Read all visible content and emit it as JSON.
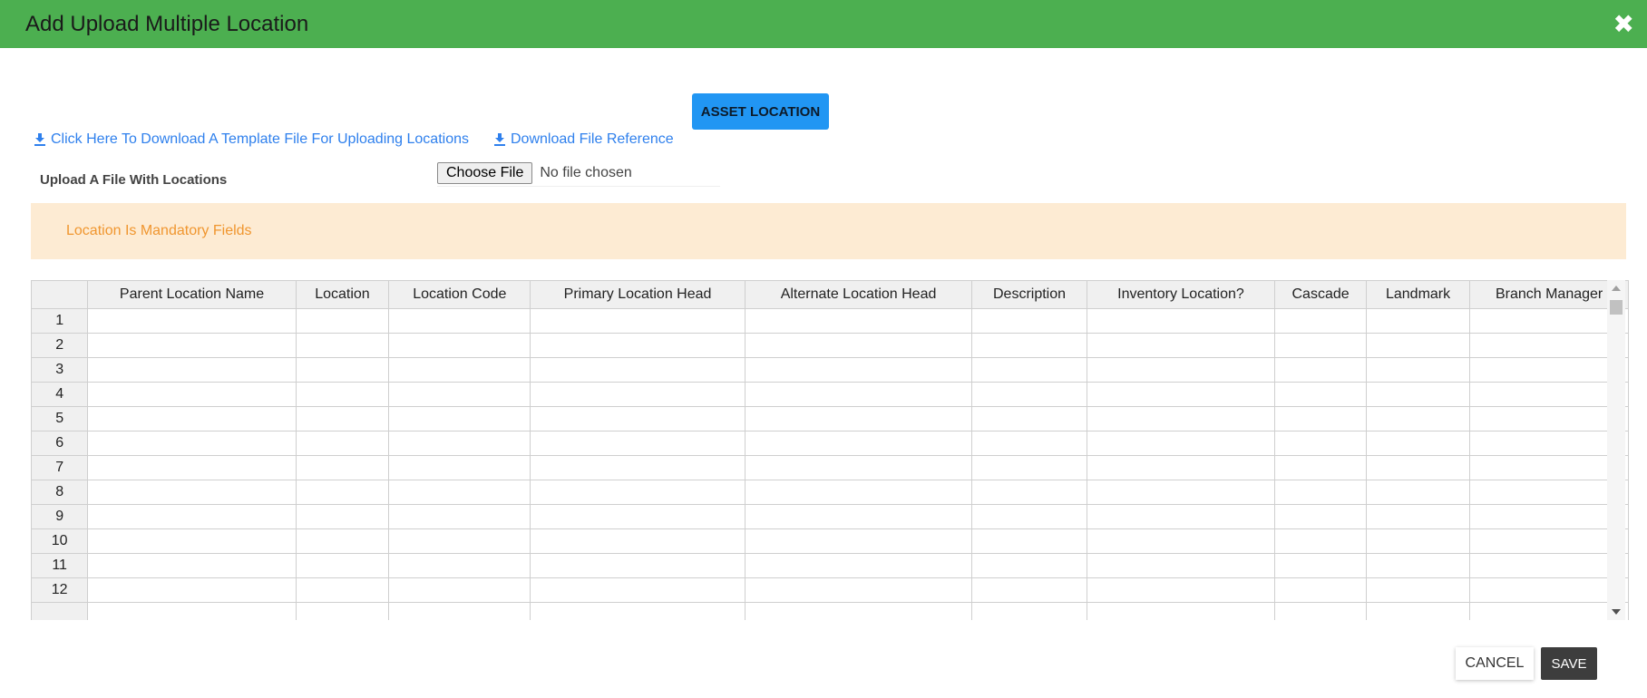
{
  "header": {
    "title": "Add Upload Multiple Location",
    "close_icon": "close-icon"
  },
  "asset_button": {
    "label": "ASSET LOCATION"
  },
  "links": {
    "template": "Click Here To Download A Template File For Uploading Locations",
    "reference": "Download File Reference"
  },
  "upload": {
    "label": "Upload A File With Locations",
    "choose_label": "Choose File",
    "status": "No file chosen"
  },
  "alert": {
    "text": "Location Is Mandatory Fields"
  },
  "grid": {
    "columns": [
      "Parent Location Name",
      "Location",
      "Location Code",
      "Primary Location Head",
      "Alternate Location Head",
      "Description",
      "Inventory Location?",
      "Cascade",
      "Landmark",
      "Branch Manager"
    ],
    "rows": [
      "1",
      "2",
      "3",
      "4",
      "5",
      "6",
      "7",
      "8",
      "9",
      "10",
      "11",
      "12",
      ""
    ]
  },
  "footer": {
    "cancel_label": "CANCEL",
    "save_label": "SAVE"
  },
  "colors": {
    "header_bg": "#4caf50",
    "accent_blue": "#2196f3",
    "link": "#2f80ed",
    "alert_bg": "#fdebd3",
    "alert_text": "#f0962f"
  }
}
